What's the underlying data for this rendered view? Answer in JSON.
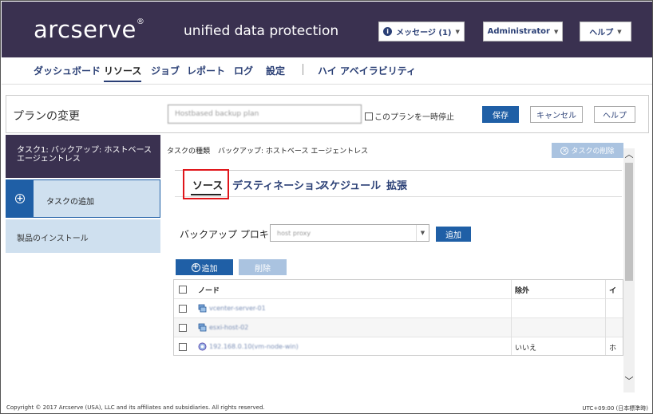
{
  "header": {
    "logo": "arcserve",
    "product": "unified data protection",
    "messages_label": "メッセージ (1)",
    "user_label": "Administrator",
    "help_label": "ヘルプ"
  },
  "nav": {
    "items": [
      "ダッシュボード",
      "リソース",
      "ジョブ",
      "レポート",
      "ログ",
      "設定",
      "ハイ アベイラビリティ"
    ],
    "active": "リソース"
  },
  "plan": {
    "title": "プランの変更",
    "name_value": "Hostbased backup plan",
    "pause_label": "このプランを一時停止",
    "save_label": "保存",
    "cancel_label": "キャンセル",
    "help_label": "ヘルプ"
  },
  "sidebar": {
    "task1": "タスク1: バックアップ: ホストベース エージェントレス",
    "add_task": "タスクの追加",
    "install": "製品のインストール"
  },
  "task": {
    "type_label": "タスクの種類",
    "type_value": "バックアップ: ホストベース エージェントレス",
    "delete_label": "タスクの削除"
  },
  "tabs": [
    "ソース",
    "デスティネーション",
    "スケジュール",
    "拡張"
  ],
  "proxy": {
    "label": "バックアップ プロキシ",
    "value": "host proxy",
    "add_label": "追加"
  },
  "nodes": {
    "add_label": "追加",
    "remove_label": "削除",
    "columns": [
      "ノード",
      "除外",
      "イ"
    ],
    "rows": [
      {
        "name": "vcenter-server-01",
        "exclude": "",
        "extra": ""
      },
      {
        "name": "esxi-host-02",
        "exclude": "",
        "extra": ""
      },
      {
        "name": "192.168.0.10(vm-node-win)",
        "exclude": "いいえ",
        "extra": "ホ"
      }
    ]
  },
  "footer": {
    "copyright": "Copyright © 2017 Arcserve (USA), LLC and its affiliates and subsidiaries. All rights reserved.",
    "timezone": "UTC+09:00 (日本標準時)"
  },
  "colors": {
    "header_bg": "#3a3150",
    "primary": "#1f5fa6",
    "highlight": "#e0151b"
  }
}
